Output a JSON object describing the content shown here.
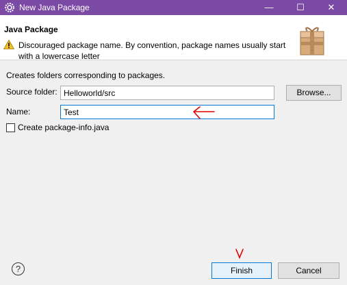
{
  "window": {
    "title": "New Java Package",
    "app_icon": "eclipse-gear-icon",
    "controls": {
      "minimize": "—",
      "maximize": "☐",
      "close": "✕"
    }
  },
  "header": {
    "title": "Java Package",
    "warning_icon": "warning-triangle-icon",
    "message": "Discouraged package name. By convention, package names usually start with a lowercase letter",
    "banner_icon": "package-box-icon"
  },
  "form": {
    "description": "Creates folders corresponding to packages.",
    "source_folder_label": "Source folder:",
    "source_folder_value": "Helloworld/src",
    "browse_label": "Browse...",
    "name_label": "Name:",
    "name_value": "Test",
    "create_info_label": "Create package-info.java",
    "create_info_checked": false
  },
  "footer": {
    "help_label": "?",
    "finish_label": "Finish",
    "cancel_label": "Cancel"
  },
  "colors": {
    "titlebar": "#7a4aa5",
    "focus_border": "#0078d7",
    "annotation": "#e00000"
  }
}
